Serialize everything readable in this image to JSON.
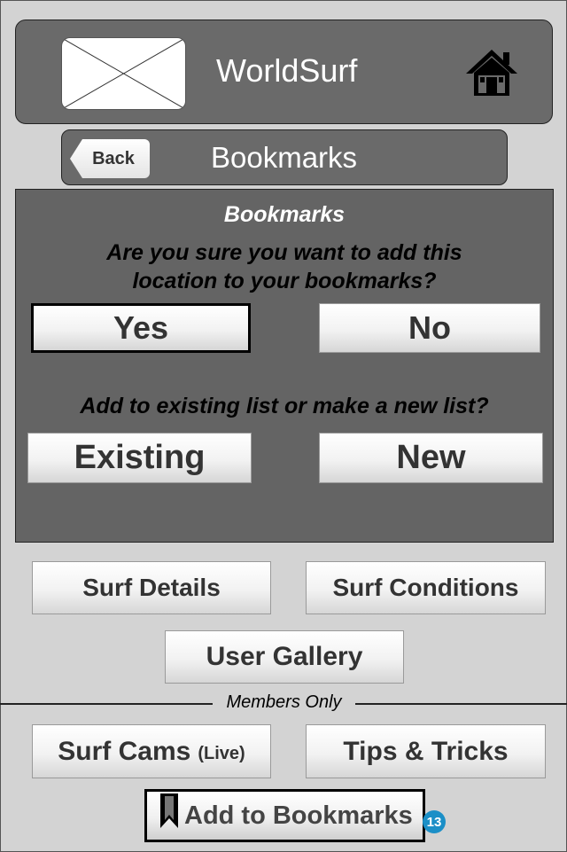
{
  "header": {
    "title": "WorldSurf",
    "logo_icon": "logo-placeholder-icon",
    "home_icon": "home-icon"
  },
  "subheader": {
    "back_label": "Back",
    "title": "Bookmarks"
  },
  "dialog": {
    "title": "Bookmarks",
    "question1_line1": "Are you sure you want to add this",
    "question1_line2": "location to your bookmarks?",
    "yes_label": "Yes",
    "no_label": "No",
    "question2": "Add to existing list or make a new list?",
    "existing_label": "Existing",
    "new_label": "New"
  },
  "nav": {
    "surf_details": "Surf Details",
    "surf_conditions": "Surf Conditions",
    "user_gallery": "User Gallery",
    "members_only": "Members Only",
    "surf_cams": "Surf Cams",
    "surf_cams_suffix": "(Live)",
    "tips_tricks": "Tips & Tricks"
  },
  "bookmark_button": {
    "label": "Add to Bookmarks",
    "icon": "bookmark-icon",
    "badge": "13"
  },
  "colors": {
    "panel": "#646464",
    "header": "#6a6a6a",
    "background": "#d3d3d3",
    "badge": "#1b8fc7"
  }
}
